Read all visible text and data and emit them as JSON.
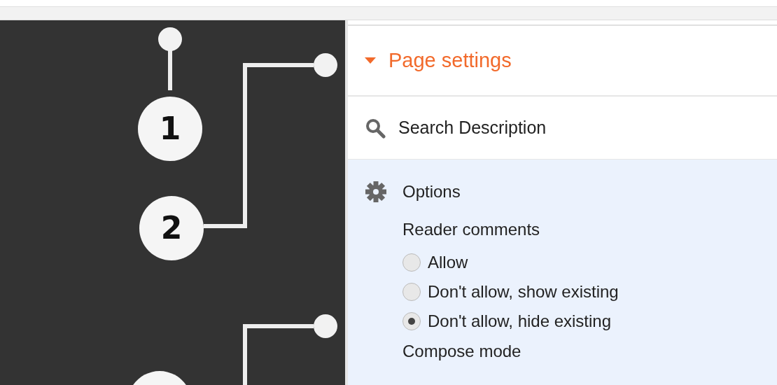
{
  "callouts": [
    {
      "label": "1"
    },
    {
      "label": "2"
    }
  ],
  "panel": {
    "title": "Page settings",
    "expanded": true,
    "search_description": {
      "label": "Search Description"
    },
    "options": {
      "label": "Options",
      "reader_comments": {
        "label": "Reader comments",
        "choices": [
          {
            "label": "Allow",
            "selected": false
          },
          {
            "label": "Don't allow, show existing",
            "selected": false
          },
          {
            "label": "Don't allow, hide existing",
            "selected": true
          }
        ]
      },
      "compose_mode": {
        "label": "Compose mode"
      }
    }
  }
}
